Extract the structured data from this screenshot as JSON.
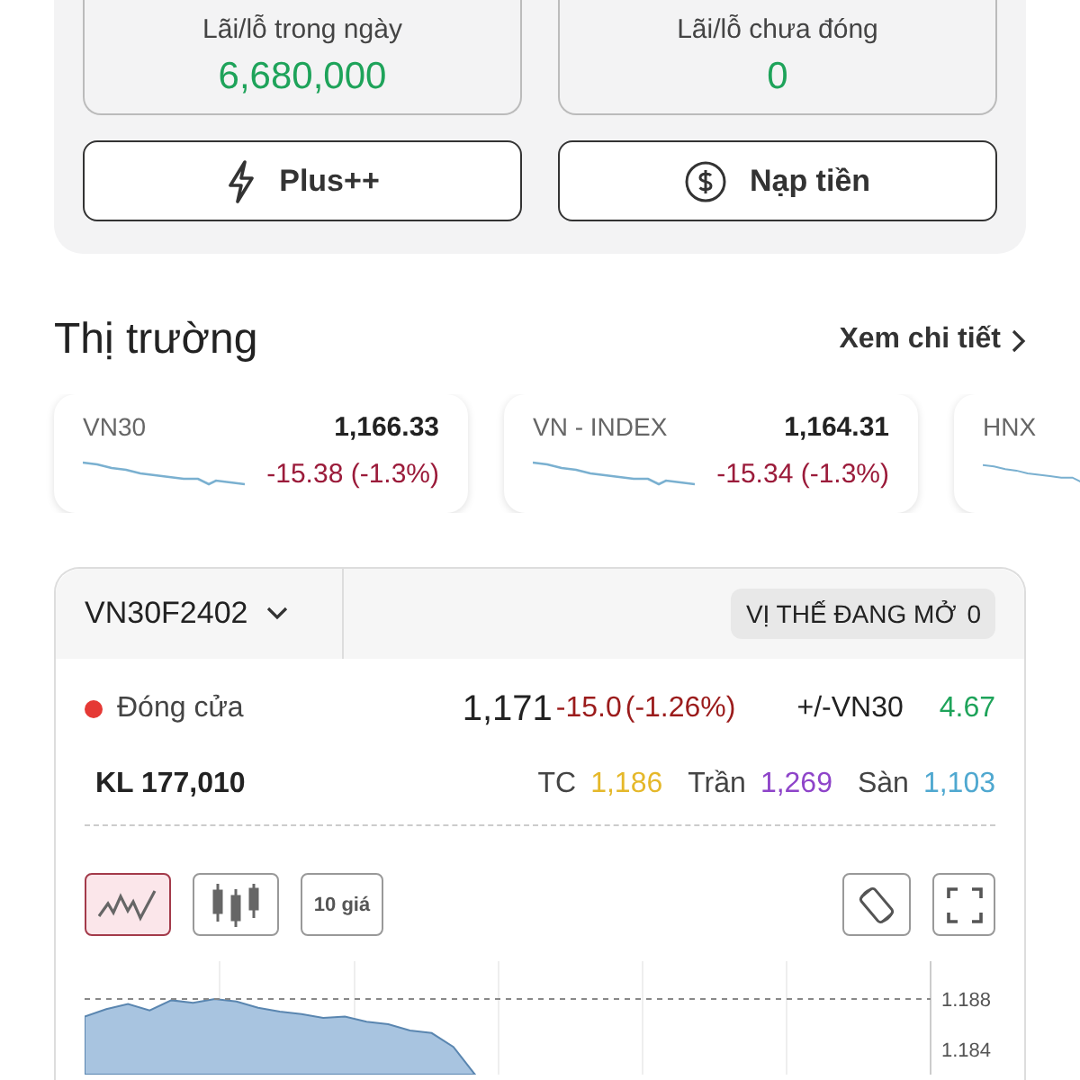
{
  "summary": {
    "stats": [
      {
        "label": "Lãi/lỗ trong ngày",
        "value": "6,680,000"
      },
      {
        "label": "Lãi/lỗ chưa đóng",
        "value": "0"
      }
    ],
    "buttons": [
      {
        "label": "Plus++"
      },
      {
        "label": "Nạp tiền"
      }
    ]
  },
  "market": {
    "title": "Thị trường",
    "link": "Xem chi tiết",
    "indices": [
      {
        "name": "VN30",
        "value": "1,166.33",
        "change": "-15.38 (-1.3%)"
      },
      {
        "name": "VN - INDEX",
        "value": "1,164.31",
        "change": "-15.34 (-1.3%)"
      },
      {
        "name": "HNX"
      }
    ]
  },
  "futures": {
    "symbol": "VN30F2402",
    "open_positions": "VỊ THẾ ĐANG MỞ",
    "open_count": "0",
    "status": {
      "label": "Đóng cửa",
      "color": "#e53935"
    },
    "price": "1,171",
    "change": "-15.0",
    "change_pct": "(-1.26%)",
    "basis_label": "+/-VN30",
    "basis": "4.67",
    "volume": "KL 177,010",
    "refs": [
      {
        "label": "TC",
        "value": "1,186",
        "color": "#e5b82a"
      },
      {
        "label": "Trần",
        "value": "1,269",
        "color": "#8e44c9"
      },
      {
        "label": "Sàn",
        "value": "1,103",
        "color": "#4fa8d0"
      }
    ],
    "tools": [
      {
        "kind": "line",
        "selected": true
      },
      {
        "kind": "candle",
        "selected": false
      },
      {
        "kind": "text",
        "label": "10 giá",
        "selected": false
      }
    ],
    "chart_data": {
      "type": "area",
      "yticks": [
        1.188,
        1.184
      ],
      "ylim": [
        1.182,
        1.191
      ],
      "grid": true,
      "series": [
        {
          "color": "#5a86b0",
          "values": [
            1.1866,
            1.1872,
            1.1876,
            1.1871,
            1.1879,
            1.1877,
            1.188,
            1.1878,
            1.1873,
            1.187,
            1.1868,
            1.1865,
            1.1866,
            1.1862,
            1.186,
            1.1855,
            1.1853,
            1.1842,
            1.182,
            null,
            null,
            null,
            null,
            null,
            null,
            null,
            null,
            null,
            null,
            null,
            null,
            null,
            null,
            null,
            null,
            null,
            null,
            null,
            null,
            null
          ]
        },
        {
          "color": "#888888",
          "type": "line",
          "line_style": "dashed",
          "values": [
            1.188,
            1.188,
            1.188,
            1.188,
            1.188,
            1.188,
            1.188,
            1.188,
            1.188,
            1.188,
            1.188,
            1.188,
            1.188,
            1.188,
            1.188,
            1.188,
            1.188,
            1.188,
            1.188,
            1.188,
            1.188,
            1.188,
            1.188,
            1.188,
            1.188,
            1.188,
            1.188,
            1.188,
            1.188,
            1.188,
            1.188,
            1.188,
            1.188,
            1.188,
            1.188,
            1.188,
            1.188,
            1.188,
            1.188,
            1.188
          ]
        }
      ]
    }
  }
}
